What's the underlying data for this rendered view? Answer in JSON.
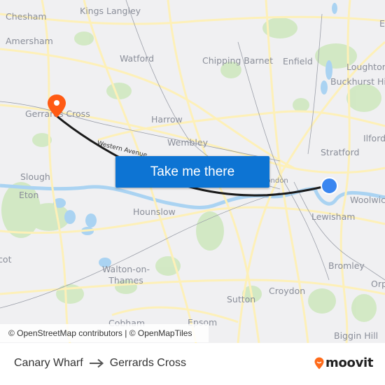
{
  "map": {
    "places": [
      {
        "name": "Chesham"
      },
      {
        "name": "Kings Langley"
      },
      {
        "name": "Amersham"
      },
      {
        "name": "Watford"
      },
      {
        "name": "Chipping Barnet"
      },
      {
        "name": "Enfield"
      },
      {
        "name": "Loughton"
      },
      {
        "name": "Buckhurst Hill"
      },
      {
        "name": "Gerrards Cross"
      },
      {
        "name": "Harrow"
      },
      {
        "name": "Ilford"
      },
      {
        "name": "Wembley"
      },
      {
        "name": "Stratford"
      },
      {
        "name": "Slough"
      },
      {
        "name": "London"
      },
      {
        "name": "Eton"
      },
      {
        "name": "Woolwich"
      },
      {
        "name": "Hounslow"
      },
      {
        "name": "Lewisham"
      },
      {
        "name": "Ascot"
      },
      {
        "name": "Bromley"
      },
      {
        "name": "Walton-on-Thames"
      },
      {
        "name": "Orpington"
      },
      {
        "name": "Croydon"
      },
      {
        "name": "Sutton"
      },
      {
        "name": "Cobham"
      },
      {
        "name": "Epsom"
      },
      {
        "name": "Biggin Hill"
      },
      {
        "name": "Epping"
      }
    ],
    "road_label": "Western Avenue",
    "origin_marker": {
      "icon": "origin-dot-icon",
      "color": "#3a86f0",
      "label": "Canary Wharf"
    },
    "destination_marker": {
      "icon": "destination-pin-icon",
      "color": "#ff5a14",
      "label": "Gerrards Cross"
    },
    "route_color": "#1a1a1a",
    "cta_button": {
      "label": "Take me there",
      "color": "#0d74d3"
    },
    "attribution": "© OpenStreetMap contributors | © OpenMapTiles"
  },
  "footer": {
    "origin": "Canary Wharf",
    "arrow_icon": "arrow-right-icon",
    "destination": "Gerrards Cross",
    "logo": {
      "text": "moovit",
      "icon": "moovit-pin-icon",
      "color": "#ff6b1a"
    }
  }
}
